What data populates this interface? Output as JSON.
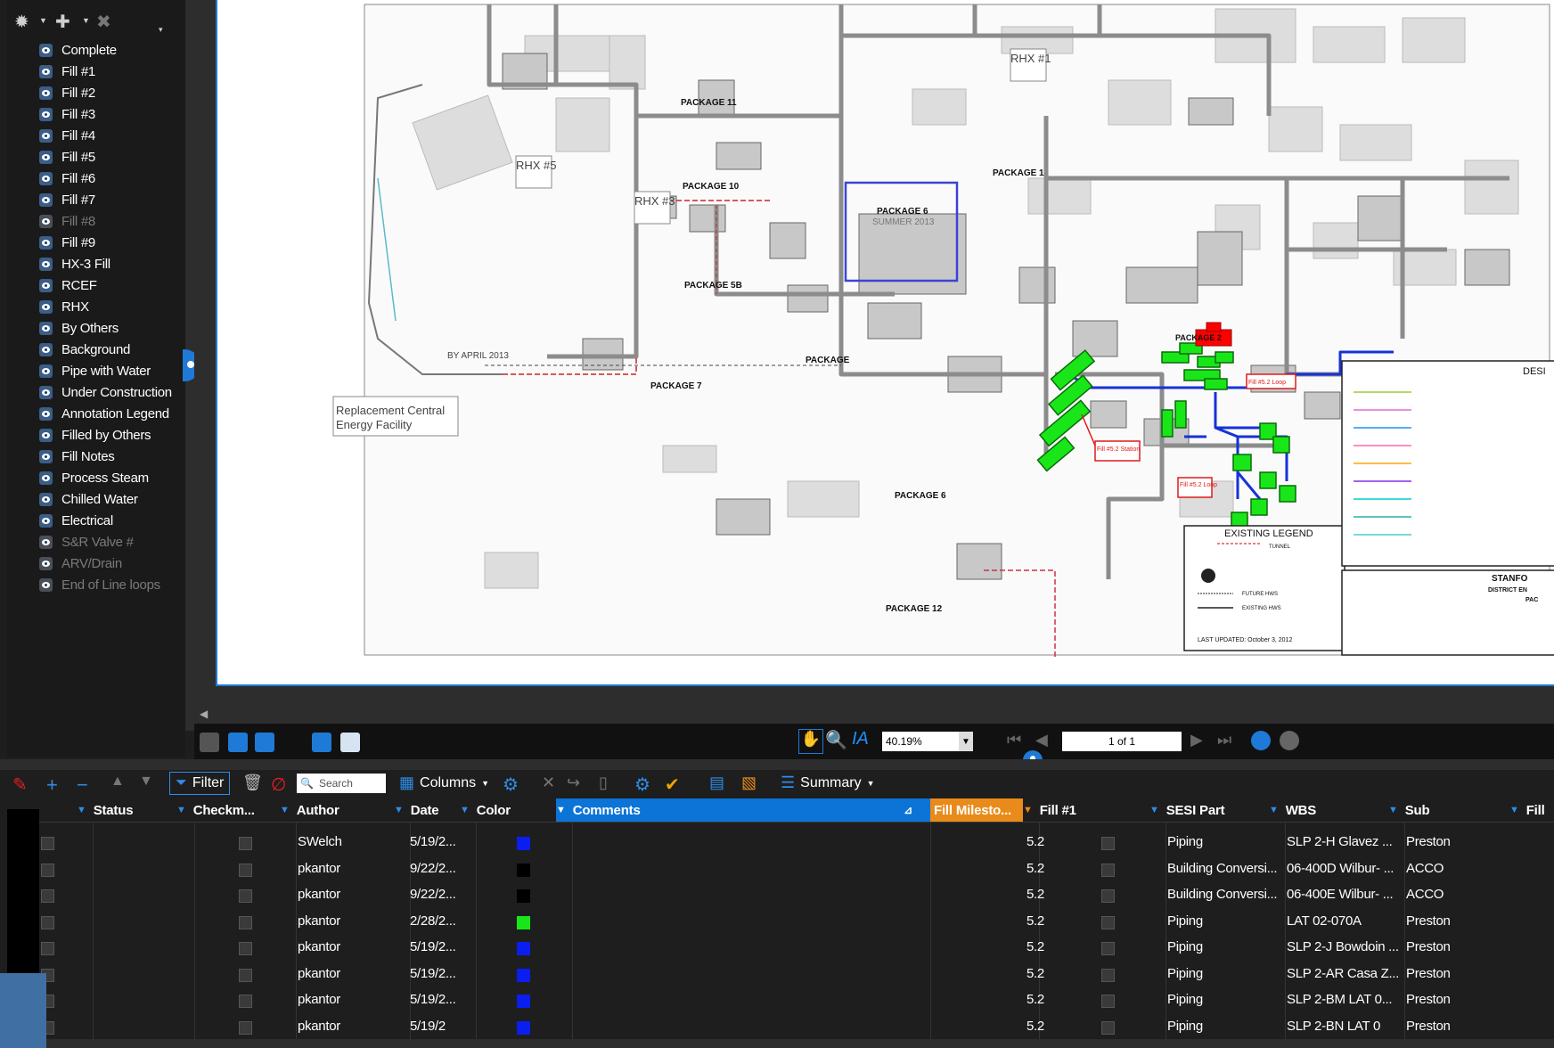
{
  "layers_panel": {
    "items": [
      {
        "label": "Complete",
        "visible": true
      },
      {
        "label": "Fill #1",
        "visible": true
      },
      {
        "label": "Fill #2",
        "visible": true
      },
      {
        "label": "Fill #3",
        "visible": true
      },
      {
        "label": "Fill #4",
        "visible": true
      },
      {
        "label": "Fill #5",
        "visible": true
      },
      {
        "label": "Fill #6",
        "visible": true
      },
      {
        "label": "Fill #7",
        "visible": true
      },
      {
        "label": "Fill #8",
        "visible": false
      },
      {
        "label": "Fill #9",
        "visible": true
      },
      {
        "label": "HX-3 Fill",
        "visible": true
      },
      {
        "label": "RCEF",
        "visible": true
      },
      {
        "label": "RHX",
        "visible": true
      },
      {
        "label": "By Others",
        "visible": true
      },
      {
        "label": "Background",
        "visible": true
      },
      {
        "label": "Pipe with Water",
        "visible": true
      },
      {
        "label": "Under Construction",
        "visible": true
      },
      {
        "label": "Annotation Legend",
        "visible": true
      },
      {
        "label": "Filled by Others",
        "visible": true
      },
      {
        "label": "Fill Notes",
        "visible": true
      },
      {
        "label": "Process Steam",
        "visible": true
      },
      {
        "label": "Chilled Water",
        "visible": true
      },
      {
        "label": "Electrical",
        "visible": true
      },
      {
        "label": "S&R Valve #",
        "visible": false
      },
      {
        "label": "ARV/Drain",
        "visible": false
      },
      {
        "label": "End of Line loops",
        "visible": false
      }
    ]
  },
  "drawing": {
    "labels": {
      "rhx1": "RHX #1",
      "rhx5": "RHX #5",
      "rhx3": "RHX #3",
      "pkg1": "PACKAGE 1",
      "pkg6": "PACKAGE 6",
      "summer": "SUMMER 2013",
      "pkg10": "PACKAGE 10",
      "pkg11": "PACKAGE 11",
      "pkg5b": "PACKAGE 5B",
      "pkg7": "PACKAGE 7",
      "pkg6b": "PACKAGE 6",
      "pkg12": "PACKAGE 12",
      "pkg": "PACKAGE",
      "pkg2": "PACKAGE 2",
      "by_april": "BY APRIL 2013",
      "rcef_line1": "Replacement Central",
      "rcef_line2": "Energy Facility",
      "legend_title": "EXISTING LEGEND",
      "legend_tunnel": "TUNNEL",
      "legend_future": "FUTURE HWS",
      "legend_existing": "EXISTING HWS",
      "last_updated": "LAST UPDATED: October 3, 2012",
      "desi": "DESI",
      "stanfo": "STANFO",
      "district": "DISTRICT EN",
      "pac": "PAC",
      "fill52": "Fill #5.2 Loop",
      "fill52b": "Fill #5.2 Station",
      "fill52c": "Fill #5.2 Loop"
    }
  },
  "navbar": {
    "zoom": "40.19%",
    "page": "1 of 1"
  },
  "list_toolbar": {
    "filter_label": "Filter",
    "search_placeholder": "Search",
    "columns_label": "Columns",
    "summary_label": "Summary"
  },
  "table": {
    "columns": {
      "status": "Status",
      "checkmark": "Checkm...",
      "author": "Author",
      "date": "Date",
      "color": "Color",
      "comments": "Comments",
      "fill_milestone": "Fill Milesto...",
      "fill1": "Fill #1",
      "sesi": "SESI Part",
      "wbs": "WBS",
      "sub": "Sub",
      "fill": "Fill"
    },
    "rows": [
      {
        "author": "SWelch",
        "date": "5/19/2...",
        "color": "#0a1ef0",
        "milestone": "5.2",
        "sesi": "Piping",
        "wbs": "SLP 2-H Glavez ...",
        "sub": "Preston"
      },
      {
        "author": "pkantor",
        "date": "9/22/2...",
        "color": "#000000",
        "milestone": "5.2",
        "sesi": "Building Conversi...",
        "wbs": "06-400D Wilbur- ...",
        "sub": "ACCO"
      },
      {
        "author": "pkantor",
        "date": "9/22/2...",
        "color": "#000000",
        "milestone": "5.2",
        "sesi": "Building Conversi...",
        "wbs": "06-400E Wilbur- ...",
        "sub": "ACCO"
      },
      {
        "author": "pkantor",
        "date": "2/28/2...",
        "color": "#19e619",
        "milestone": "5.2",
        "sesi": "Piping",
        "wbs": "LAT 02-070A",
        "sub": "Preston"
      },
      {
        "author": "pkantor",
        "date": "5/19/2...",
        "color": "#0a1ef0",
        "milestone": "5.2",
        "sesi": "Piping",
        "wbs": "SLP 2-J Bowdoin ...",
        "sub": "Preston"
      },
      {
        "author": "pkantor",
        "date": "5/19/2...",
        "color": "#0a1ef0",
        "milestone": "5.2",
        "sesi": "Piping",
        "wbs": "SLP 2-AR Casa Z...",
        "sub": "Preston"
      },
      {
        "author": "pkantor",
        "date": "5/19/2...",
        "color": "#0a1ef0",
        "milestone": "5.2",
        "sesi": "Piping",
        "wbs": "SLP 2-BM LAT 0...",
        "sub": "Preston"
      },
      {
        "author": "pkantor",
        "date": "5/19/2",
        "color": "#0a1ef0",
        "milestone": "5.2",
        "sesi": "Piping",
        "wbs": "SLP 2-BN LAT 0",
        "sub": "Preston"
      }
    ]
  },
  "colors": {
    "accent": "#1e7ad6",
    "milestone_header": "#e98b1a",
    "highlight_green": "#19e619",
    "highlight_red": "#ff0000",
    "pipe_blue": "#1632d8"
  }
}
